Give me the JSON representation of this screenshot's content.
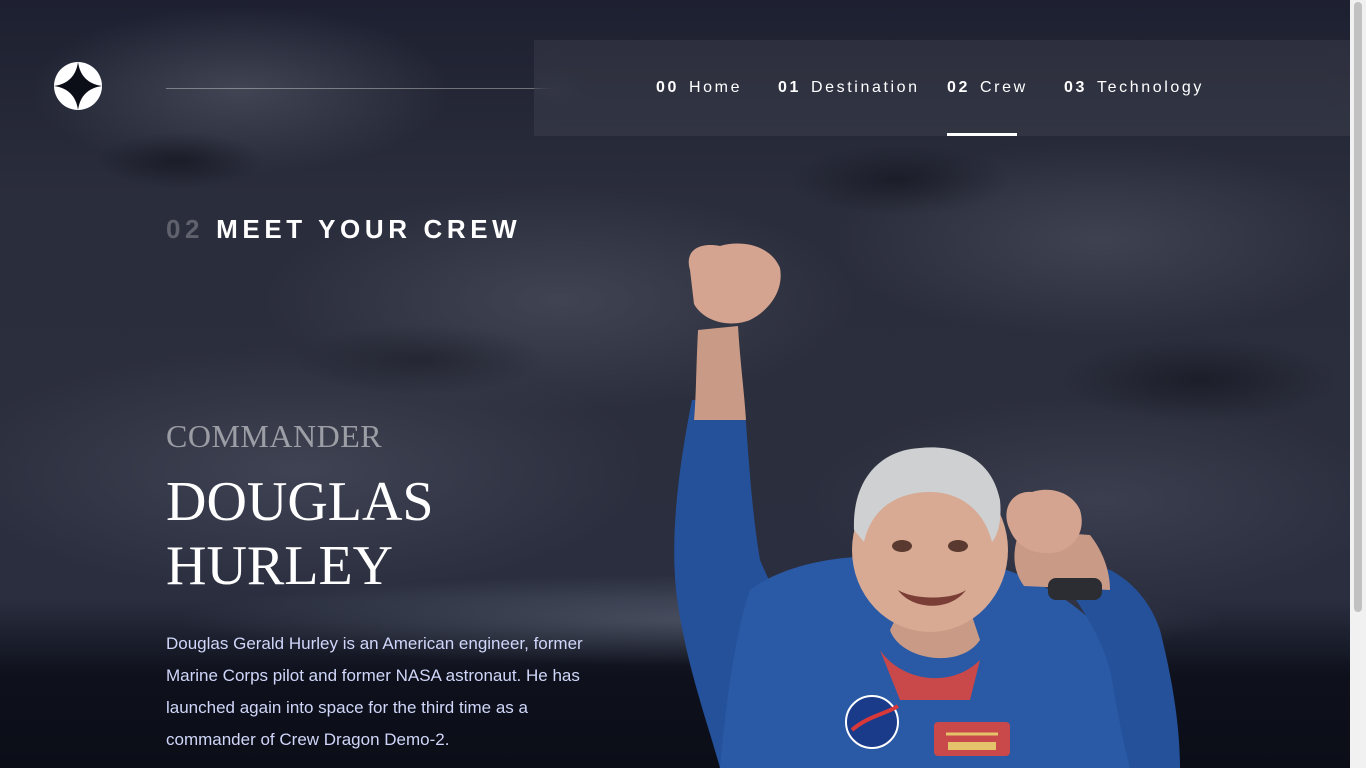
{
  "nav": {
    "items": [
      {
        "num": "00",
        "label": "Home",
        "active": false
      },
      {
        "num": "01",
        "label": "Destination",
        "active": false
      },
      {
        "num": "02",
        "label": "Crew",
        "active": true
      },
      {
        "num": "03",
        "label": "Technology",
        "active": false
      }
    ]
  },
  "page": {
    "title_num": "02",
    "title": "MEET YOUR CREW"
  },
  "crew": {
    "role": "COMMANDER",
    "name": "DOUGLAS HURLEY",
    "bio": "Douglas Gerald Hurley is an American engineer, former Marine Corps pilot and former NASA astronaut. He has launched again into space for the third time as a commander of Crew Dragon Demo-2.",
    "image_icon": "astronaut-portrait"
  },
  "colors": {
    "background": "#0b0d17",
    "text_light": "#d0d6f9",
    "accent": "#ffffff"
  }
}
